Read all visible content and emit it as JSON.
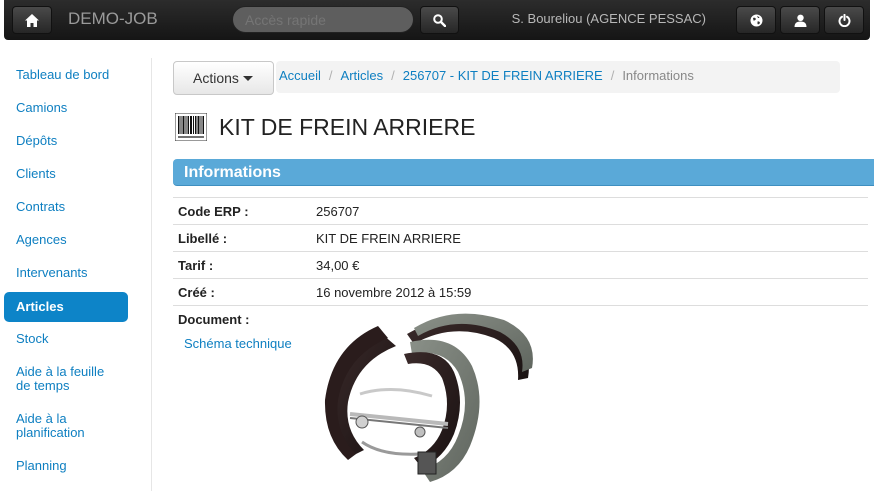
{
  "navbar": {
    "brand": "DEMO-JOB",
    "search_placeholder": "Accès rapide",
    "user": "S. Boureliou (AGENCE PESSAC)",
    "icons": [
      "home-icon",
      "search-icon",
      "globe-icon",
      "user-icon",
      "power-icon"
    ]
  },
  "sidebar": {
    "items": [
      {
        "label": "Tableau de bord"
      },
      {
        "label": "Camions"
      },
      {
        "label": "Dépôts"
      },
      {
        "label": "Clients"
      },
      {
        "label": "Contrats"
      },
      {
        "label": "Agences"
      },
      {
        "label": "Intervenants"
      },
      {
        "label": "Articles",
        "active": true
      },
      {
        "label": "Stock"
      },
      {
        "label": "Aide à la feuille de temps"
      },
      {
        "label": "Aide à la planification"
      },
      {
        "label": "Planning"
      }
    ]
  },
  "actions_label": "Actions",
  "breadcrumb": {
    "items": [
      "Accueil",
      "Articles",
      "256707 - KIT DE FREIN ARRIERE"
    ],
    "current": "Informations"
  },
  "page_title": "KIT DE FREIN ARRIERE",
  "section_title": "Informations",
  "details": [
    {
      "label": "Code ERP :",
      "value": "256707"
    },
    {
      "label": "Libellé :",
      "value": "KIT DE FREIN ARRIERE"
    },
    {
      "label": "Tarif :",
      "value": "34,00 €"
    },
    {
      "label": "Créé :",
      "value": "16 novembre 2012 à 15:59"
    }
  ],
  "document": {
    "label": "Document :",
    "link": "Schéma technique"
  },
  "colors": {
    "accent": "#0d84c8",
    "section": "#5aa9d8",
    "navbar": "#1e1e1e"
  }
}
